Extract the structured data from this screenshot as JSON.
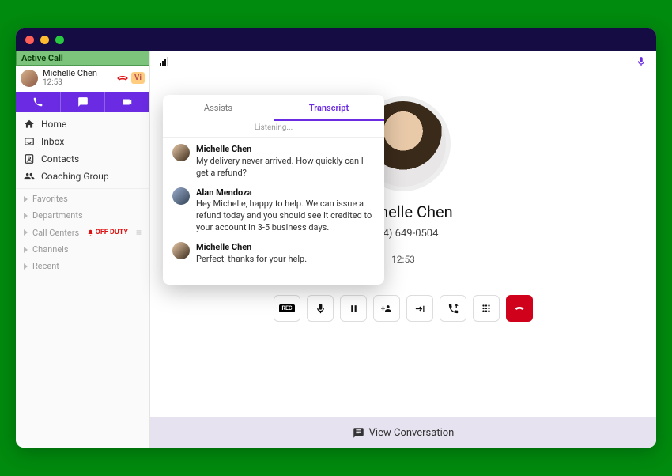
{
  "sidebar": {
    "active_call_label": "Active Call",
    "caller_name": "Michelle Chen",
    "caller_time": "12:53",
    "vi_badge": "Vi",
    "nav": [
      {
        "icon": "home",
        "label": "Home"
      },
      {
        "icon": "inbox",
        "label": "Inbox"
      },
      {
        "icon": "contacts",
        "label": "Contacts"
      },
      {
        "icon": "group",
        "label": "Coaching Group"
      }
    ],
    "sections": [
      {
        "label": "Favorites"
      },
      {
        "label": "Departments"
      },
      {
        "label": "Call Centers",
        "off_duty": "OFF DUTY"
      },
      {
        "label": "Channels"
      },
      {
        "label": "Recent"
      }
    ]
  },
  "popover": {
    "tabs": {
      "assists": "Assists",
      "transcript": "Transcript"
    },
    "listening": "Listening...",
    "messages": [
      {
        "name": "Michelle Chen",
        "text": "My delivery never arrived. How quickly can I get a refund?",
        "avatar": "av1"
      },
      {
        "name": "Alan Mendoza",
        "text": "Hey Michelle, happy to help. We can issue a refund today and you should see it credited to your account in 3-5 business days.",
        "avatar": "av2"
      },
      {
        "name": "Michelle Chen",
        "text": "Perfect, thanks for your help.",
        "avatar": "av1"
      }
    ]
  },
  "call": {
    "name": "Michelle Chen",
    "phone": "(804) 649-0504",
    "duration": "12:53"
  },
  "footer": {
    "view_conversation": "View Conversation"
  },
  "controls": {
    "rec": "REC"
  }
}
